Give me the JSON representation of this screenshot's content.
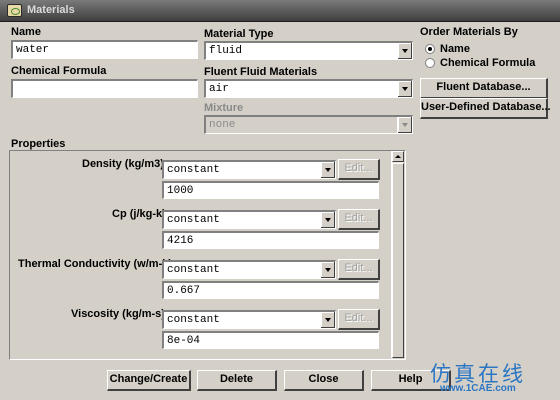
{
  "window": {
    "title": "Materials"
  },
  "name": {
    "label": "Name",
    "value": "water"
  },
  "chemical_formula": {
    "label": "Chemical Formula",
    "value": ""
  },
  "material_type": {
    "label": "Material Type",
    "value": "fluid"
  },
  "fluent_fluid_materials": {
    "label": "Fluent Fluid Materials",
    "value": "air"
  },
  "mixture": {
    "label": "Mixture",
    "value": "none"
  },
  "order_by": {
    "label": "Order Materials By",
    "options": [
      {
        "label": "Name",
        "selected": true
      },
      {
        "label": "Chemical Formula",
        "selected": false
      }
    ]
  },
  "side_buttons": {
    "fluent_database": "Fluent Database...",
    "user_defined_database": "User-Defined Database..."
  },
  "properties": {
    "label": "Properties",
    "items": [
      {
        "label": "Density (kg/m3)",
        "method": "constant",
        "edit": "Edit...",
        "value": "1000"
      },
      {
        "label": "Cp (j/kg-k)",
        "method": "constant",
        "edit": "Edit...",
        "value": "4216"
      },
      {
        "label": "Thermal Conductivity (w/m-k)",
        "method": "constant",
        "edit": "Edit...",
        "value": "0.667"
      },
      {
        "label": "Viscosity (kg/m-s)",
        "method": "constant",
        "edit": "Edit...",
        "value": "8e-04"
      }
    ]
  },
  "footer": {
    "change_create": "Change/Create",
    "delete": "Delete",
    "close": "Close",
    "help": "Help"
  },
  "watermark": {
    "main": "仿真在线",
    "sub": "www.1CAE.com"
  },
  "colors": {
    "title_bar": "#4a4a4a",
    "dialog": "#d4d0c8",
    "watermark": "#2b76c4"
  }
}
